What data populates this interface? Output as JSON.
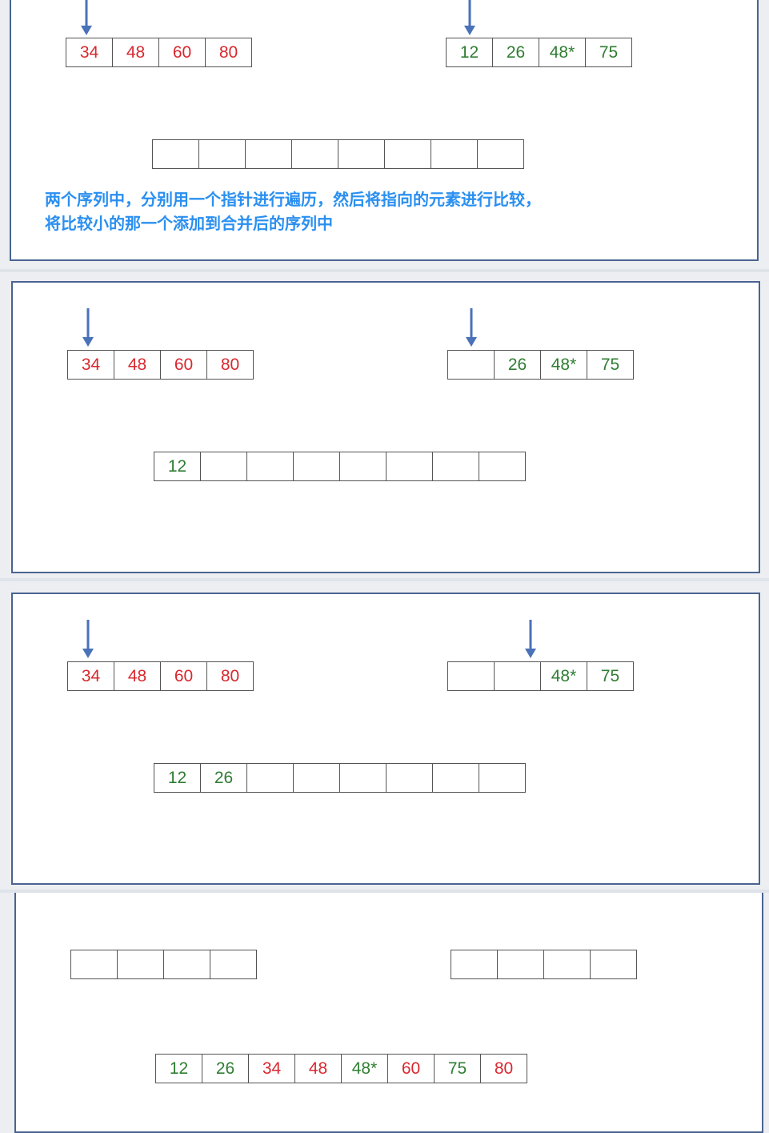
{
  "caption": {
    "line1": "两个序列中，分别用一个指针进行遍历，然后将指向的元素进行比较，",
    "line2": "将比较小的那一个添加到合并后的序列中"
  },
  "colors": {
    "left_sequence": "#d9282f",
    "right_sequence": "#2f7d32",
    "pointer": "#4a72b8",
    "caption": "#2a8ff0"
  },
  "icons": {
    "pointer": "down-arrow-icon"
  },
  "steps": [
    {
      "left": [
        {
          "v": "34",
          "c": "red"
        },
        {
          "v": "48",
          "c": "red"
        },
        {
          "v": "60",
          "c": "red"
        },
        {
          "v": "80",
          "c": "red"
        }
      ],
      "right": [
        {
          "v": "12",
          "c": "green"
        },
        {
          "v": "26",
          "c": "green"
        },
        {
          "v": "48*",
          "c": "green"
        },
        {
          "v": "75",
          "c": "green"
        }
      ],
      "merged": [
        {
          "v": "",
          "c": ""
        },
        {
          "v": "",
          "c": ""
        },
        {
          "v": "",
          "c": ""
        },
        {
          "v": "",
          "c": ""
        },
        {
          "v": "",
          "c": ""
        },
        {
          "v": "",
          "c": ""
        },
        {
          "v": "",
          "c": ""
        },
        {
          "v": "",
          "c": ""
        }
      ]
    },
    {
      "left": [
        {
          "v": "34",
          "c": "red"
        },
        {
          "v": "48",
          "c": "red"
        },
        {
          "v": "60",
          "c": "red"
        },
        {
          "v": "80",
          "c": "red"
        }
      ],
      "right": [
        {
          "v": "",
          "c": ""
        },
        {
          "v": "26",
          "c": "green"
        },
        {
          "v": "48*",
          "c": "green"
        },
        {
          "v": "75",
          "c": "green"
        }
      ],
      "merged": [
        {
          "v": "12",
          "c": "green"
        },
        {
          "v": "",
          "c": ""
        },
        {
          "v": "",
          "c": ""
        },
        {
          "v": "",
          "c": ""
        },
        {
          "v": "",
          "c": ""
        },
        {
          "v": "",
          "c": ""
        },
        {
          "v": "",
          "c": ""
        },
        {
          "v": "",
          "c": ""
        }
      ]
    },
    {
      "left": [
        {
          "v": "34",
          "c": "red"
        },
        {
          "v": "48",
          "c": "red"
        },
        {
          "v": "60",
          "c": "red"
        },
        {
          "v": "80",
          "c": "red"
        }
      ],
      "right": [
        {
          "v": "",
          "c": ""
        },
        {
          "v": "",
          "c": ""
        },
        {
          "v": "48*",
          "c": "green"
        },
        {
          "v": "75",
          "c": "green"
        }
      ],
      "merged": [
        {
          "v": "12",
          "c": "green"
        },
        {
          "v": "26",
          "c": "green"
        },
        {
          "v": "",
          "c": ""
        },
        {
          "v": "",
          "c": ""
        },
        {
          "v": "",
          "c": ""
        },
        {
          "v": "",
          "c": ""
        },
        {
          "v": "",
          "c": ""
        },
        {
          "v": "",
          "c": ""
        }
      ]
    },
    {
      "left": [
        {
          "v": "",
          "c": ""
        },
        {
          "v": "",
          "c": ""
        },
        {
          "v": "",
          "c": ""
        },
        {
          "v": "",
          "c": ""
        }
      ],
      "right": [
        {
          "v": "",
          "c": ""
        },
        {
          "v": "",
          "c": ""
        },
        {
          "v": "",
          "c": ""
        },
        {
          "v": "",
          "c": ""
        }
      ],
      "merged": [
        {
          "v": "12",
          "c": "green"
        },
        {
          "v": "26",
          "c": "green"
        },
        {
          "v": "34",
          "c": "red"
        },
        {
          "v": "48",
          "c": "red"
        },
        {
          "v": "48*",
          "c": "green"
        },
        {
          "v": "60",
          "c": "red"
        },
        {
          "v": "75",
          "c": "green"
        },
        {
          "v": "80",
          "c": "red"
        }
      ]
    }
  ]
}
